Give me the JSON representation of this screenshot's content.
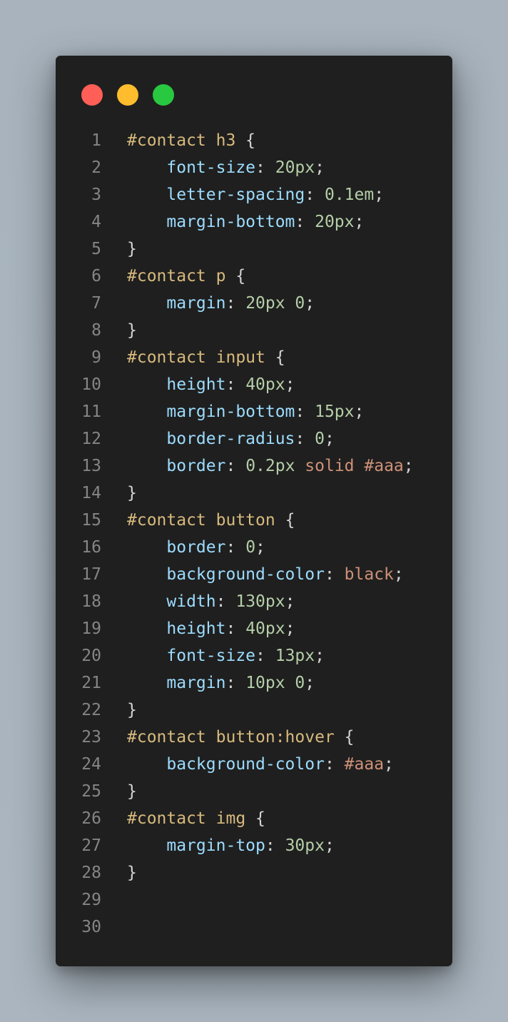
{
  "window": {
    "controls": [
      "close-dot",
      "minimize-dot",
      "maximize-dot"
    ]
  },
  "colors": {
    "selector": "#d7ba7d",
    "property": "#9cdcfe",
    "number": "#b5cea8",
    "keyword": "#ce9178",
    "punctuation": "#d4d4d4",
    "line_number": "#858585",
    "editor_bg": "#1f1f1f"
  },
  "editor": {
    "lines": [
      {
        "n": "1",
        "tokens": [
          {
            "t": "sel",
            "v": "#contact h3"
          },
          {
            "t": "punc",
            "v": " {"
          }
        ]
      },
      {
        "n": "2",
        "tokens": [
          {
            "t": "punc",
            "v": "    "
          },
          {
            "t": "prop",
            "v": "font-size"
          },
          {
            "t": "punc",
            "v": ": "
          },
          {
            "t": "num",
            "v": "20px"
          },
          {
            "t": "punc",
            "v": ";"
          }
        ]
      },
      {
        "n": "3",
        "tokens": [
          {
            "t": "punc",
            "v": "    "
          },
          {
            "t": "prop",
            "v": "letter-spacing"
          },
          {
            "t": "punc",
            "v": ": "
          },
          {
            "t": "num",
            "v": "0.1em"
          },
          {
            "t": "punc",
            "v": ";"
          }
        ]
      },
      {
        "n": "4",
        "tokens": [
          {
            "t": "punc",
            "v": "    "
          },
          {
            "t": "prop",
            "v": "margin-bottom"
          },
          {
            "t": "punc",
            "v": ": "
          },
          {
            "t": "num",
            "v": "20px"
          },
          {
            "t": "punc",
            "v": ";"
          }
        ]
      },
      {
        "n": "5",
        "tokens": [
          {
            "t": "punc",
            "v": "}"
          }
        ]
      },
      {
        "n": "6",
        "tokens": [
          {
            "t": "sel",
            "v": "#contact p"
          },
          {
            "t": "punc",
            "v": " {"
          }
        ]
      },
      {
        "n": "7",
        "tokens": [
          {
            "t": "punc",
            "v": "    "
          },
          {
            "t": "prop",
            "v": "margin"
          },
          {
            "t": "punc",
            "v": ": "
          },
          {
            "t": "num",
            "v": "20px 0"
          },
          {
            "t": "punc",
            "v": ";"
          }
        ]
      },
      {
        "n": "8",
        "tokens": [
          {
            "t": "punc",
            "v": "}"
          }
        ]
      },
      {
        "n": "9",
        "tokens": [
          {
            "t": "sel",
            "v": "#contact input"
          },
          {
            "t": "punc",
            "v": " {"
          }
        ]
      },
      {
        "n": "10",
        "tokens": [
          {
            "t": "punc",
            "v": "    "
          },
          {
            "t": "prop",
            "v": "height"
          },
          {
            "t": "punc",
            "v": ": "
          },
          {
            "t": "num",
            "v": "40px"
          },
          {
            "t": "punc",
            "v": ";"
          }
        ]
      },
      {
        "n": "11",
        "tokens": [
          {
            "t": "punc",
            "v": "    "
          },
          {
            "t": "prop",
            "v": "margin-bottom"
          },
          {
            "t": "punc",
            "v": ": "
          },
          {
            "t": "num",
            "v": "15px"
          },
          {
            "t": "punc",
            "v": ";"
          }
        ]
      },
      {
        "n": "12",
        "tokens": [
          {
            "t": "punc",
            "v": "    "
          },
          {
            "t": "prop",
            "v": "border-radius"
          },
          {
            "t": "punc",
            "v": ": "
          },
          {
            "t": "num",
            "v": "0"
          },
          {
            "t": "punc",
            "v": ";"
          }
        ]
      },
      {
        "n": "13",
        "tokens": [
          {
            "t": "punc",
            "v": "    "
          },
          {
            "t": "prop",
            "v": "border"
          },
          {
            "t": "punc",
            "v": ": "
          },
          {
            "t": "num",
            "v": "0.2px"
          },
          {
            "t": "punc",
            "v": " "
          },
          {
            "t": "kw",
            "v": "solid #aaa"
          },
          {
            "t": "punc",
            "v": ";"
          }
        ]
      },
      {
        "n": "14",
        "tokens": [
          {
            "t": "punc",
            "v": "}"
          }
        ]
      },
      {
        "n": "15",
        "tokens": [
          {
            "t": "sel",
            "v": "#contact button"
          },
          {
            "t": "punc",
            "v": " {"
          }
        ]
      },
      {
        "n": "16",
        "tokens": [
          {
            "t": "punc",
            "v": "    "
          },
          {
            "t": "prop",
            "v": "border"
          },
          {
            "t": "punc",
            "v": ": "
          },
          {
            "t": "num",
            "v": "0"
          },
          {
            "t": "punc",
            "v": ";"
          }
        ]
      },
      {
        "n": "17",
        "tokens": [
          {
            "t": "punc",
            "v": "    "
          },
          {
            "t": "prop",
            "v": "background-color"
          },
          {
            "t": "punc",
            "v": ": "
          },
          {
            "t": "kw",
            "v": "black"
          },
          {
            "t": "punc",
            "v": ";"
          }
        ]
      },
      {
        "n": "18",
        "tokens": [
          {
            "t": "punc",
            "v": "    "
          },
          {
            "t": "prop",
            "v": "width"
          },
          {
            "t": "punc",
            "v": ": "
          },
          {
            "t": "num",
            "v": "130px"
          },
          {
            "t": "punc",
            "v": ";"
          }
        ]
      },
      {
        "n": "19",
        "tokens": [
          {
            "t": "punc",
            "v": "    "
          },
          {
            "t": "prop",
            "v": "height"
          },
          {
            "t": "punc",
            "v": ": "
          },
          {
            "t": "num",
            "v": "40px"
          },
          {
            "t": "punc",
            "v": ";"
          }
        ]
      },
      {
        "n": "20",
        "tokens": [
          {
            "t": "punc",
            "v": "    "
          },
          {
            "t": "prop",
            "v": "font-size"
          },
          {
            "t": "punc",
            "v": ": "
          },
          {
            "t": "num",
            "v": "13px"
          },
          {
            "t": "punc",
            "v": ";"
          }
        ]
      },
      {
        "n": "21",
        "tokens": [
          {
            "t": "punc",
            "v": "    "
          },
          {
            "t": "prop",
            "v": "margin"
          },
          {
            "t": "punc",
            "v": ": "
          },
          {
            "t": "num",
            "v": "10px 0"
          },
          {
            "t": "punc",
            "v": ";"
          }
        ]
      },
      {
        "n": "22",
        "tokens": [
          {
            "t": "punc",
            "v": "}"
          }
        ]
      },
      {
        "n": "23",
        "tokens": [
          {
            "t": "sel",
            "v": "#contact button:hover"
          },
          {
            "t": "punc",
            "v": " {"
          }
        ]
      },
      {
        "n": "24",
        "tokens": [
          {
            "t": "punc",
            "v": "    "
          },
          {
            "t": "prop",
            "v": "background-color"
          },
          {
            "t": "punc",
            "v": ": "
          },
          {
            "t": "kw",
            "v": "#aaa"
          },
          {
            "t": "punc",
            "v": ";"
          }
        ]
      },
      {
        "n": "25",
        "tokens": [
          {
            "t": "punc",
            "v": "}"
          }
        ]
      },
      {
        "n": "26",
        "tokens": [
          {
            "t": "sel",
            "v": "#contact img"
          },
          {
            "t": "punc",
            "v": " {"
          }
        ]
      },
      {
        "n": "27",
        "tokens": [
          {
            "t": "punc",
            "v": "    "
          },
          {
            "t": "prop",
            "v": "margin-top"
          },
          {
            "t": "punc",
            "v": ": "
          },
          {
            "t": "num",
            "v": "30px"
          },
          {
            "t": "punc",
            "v": ";"
          }
        ]
      },
      {
        "n": "28",
        "tokens": [
          {
            "t": "punc",
            "v": "}"
          }
        ]
      },
      {
        "n": "29",
        "tokens": []
      },
      {
        "n": "30",
        "tokens": []
      }
    ]
  }
}
